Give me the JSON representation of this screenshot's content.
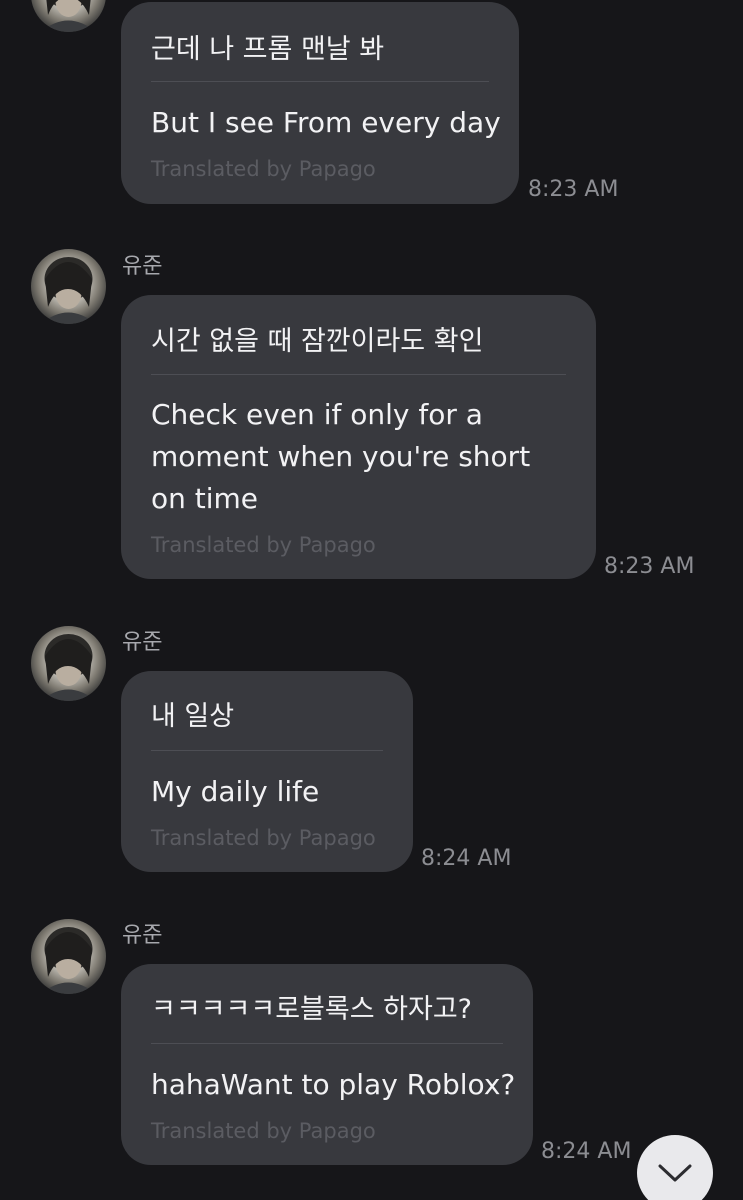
{
  "messages": [
    {
      "sender": "",
      "original": "근데 나 프롬 맨날 봐",
      "translation": "But I see From every day",
      "credit": "Translated by Papago",
      "time": "8:23 AM"
    },
    {
      "sender": "유준",
      "original": "시간 없을 때 잠깐이라도 확인",
      "translation": "Check even if only for a moment when you're short on time",
      "credit": "Translated by Papago",
      "time": "8:23 AM"
    },
    {
      "sender": "유준",
      "original": "내 일상",
      "translation": "My daily life",
      "credit": "Translated by Papago",
      "time": "8:24 AM"
    },
    {
      "sender": "유준",
      "original": "ㅋㅋㅋㅋㅋ로블록스 하자고?",
      "translation": "hahaWant to play Roblox?",
      "credit": "Translated by Papago",
      "time": "8:24 AM"
    }
  ],
  "scroll_button_icon": "chevron-down-icon"
}
